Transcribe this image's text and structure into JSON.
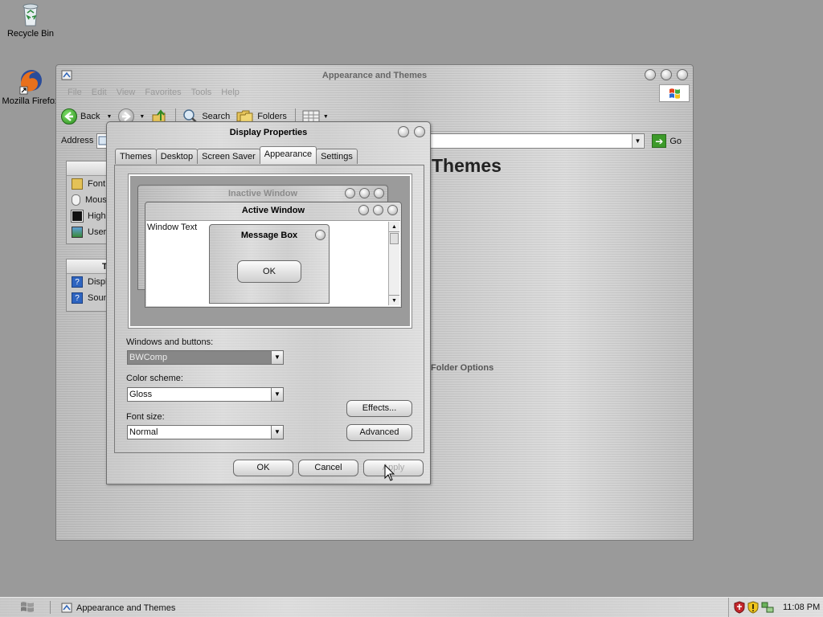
{
  "desktop": {
    "icons": [
      {
        "label": "Recycle Bin",
        "icon": "recycle-bin-icon"
      },
      {
        "label": "Mozilla Firefox",
        "icon": "firefox-icon"
      }
    ]
  },
  "explorer": {
    "title": "Appearance and Themes",
    "menu": [
      "File",
      "Edit",
      "View",
      "Favorites",
      "Tools",
      "Help"
    ],
    "toolbar": {
      "back": "Back",
      "search": "Search",
      "folders": "Folders"
    },
    "address_label": "Address",
    "go_label": "Go",
    "heading": "Themes",
    "folder_options": "Folder Options",
    "side_panel_1": {
      "items": [
        {
          "label": "Font",
          "icon": "fonts-folder-icon"
        },
        {
          "label": "Mous",
          "icon": "mouse-icon"
        },
        {
          "label": "High",
          "icon": "high-contrast-icon"
        },
        {
          "label": "User",
          "icon": "user-picture-icon"
        }
      ]
    },
    "side_panel_2": {
      "header": "T",
      "items": [
        {
          "label": "Displ",
          "icon": "help-icon"
        },
        {
          "label": "Soun",
          "icon": "help-icon"
        }
      ]
    }
  },
  "dialog": {
    "title": "Display Properties",
    "tabs": [
      "Themes",
      "Desktop",
      "Screen Saver",
      "Appearance",
      "Settings"
    ],
    "active_tab": "Appearance",
    "preview": {
      "inactive_title": "Inactive Window",
      "active_title": "Active Window",
      "window_text": "Window Text",
      "message_box_title": "Message Box",
      "ok_label": "OK"
    },
    "windows_buttons_label": "Windows and buttons:",
    "windows_buttons_value": "BWComp",
    "color_scheme_label": "Color scheme:",
    "color_scheme_value": "Gloss",
    "font_size_label": "Font size:",
    "font_size_value": "Normal",
    "effects_label": "Effects...",
    "advanced_label": "Advanced",
    "ok_label": "OK",
    "cancel_label": "Cancel",
    "apply_label": "Apply"
  },
  "taskbar": {
    "task_label": "Appearance and Themes",
    "clock": "11:08 PM"
  },
  "colors": {
    "desktop": "#9a9a9a",
    "go_green": "#3d9a2a"
  }
}
